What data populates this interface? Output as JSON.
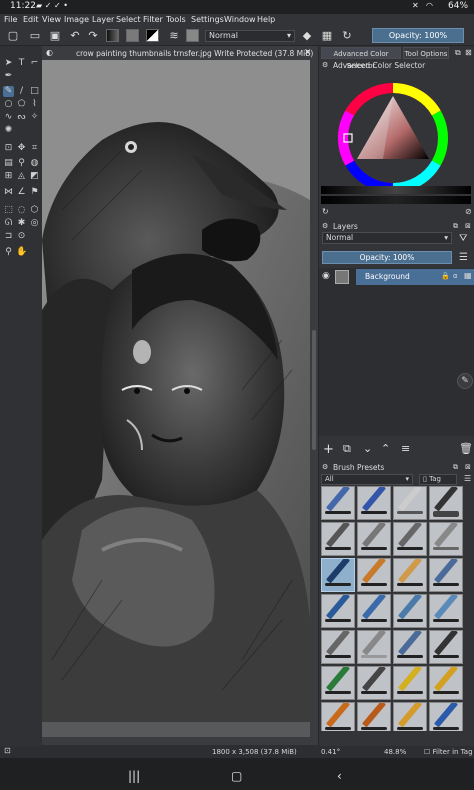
{
  "status": {
    "time": "11:22",
    "battery": "64%"
  },
  "menu": [
    "File",
    "Edit",
    "View",
    "Image",
    "Layer",
    "Select",
    "Filter",
    "Tools",
    "Settings",
    "Window",
    "Help"
  ],
  "toolbar": {
    "blend_mode": "Normal",
    "opacity_label": "Opacity: 100%"
  },
  "document": {
    "tab_title": "crow painting thumbnails trnsfer.jpg Write Protected  (37.8 MiB)"
  },
  "panel": {
    "tab_color": "Advanced Color Selector",
    "tab_options": "Tool Options",
    "color_header": "Advanced Color Selector",
    "layers_header": "Layers",
    "layer_blend": "Normal",
    "layer_opacity": "Opacity:  100%",
    "layer_name": "Background",
    "brush_header": "Brush Presets",
    "brush_filter": "All",
    "brush_tag": "Tag"
  },
  "footer": {
    "dimensions": "1800 x 3,508 (37.8 MiB)",
    "rotation": "0.41°",
    "zoom": "48.8%",
    "filter_in_tag": "Filter in Tag"
  },
  "colors": {
    "accent": "#4a6f96",
    "bg": "#2c2e31",
    "opacity_fill": "#4b6f8f"
  }
}
